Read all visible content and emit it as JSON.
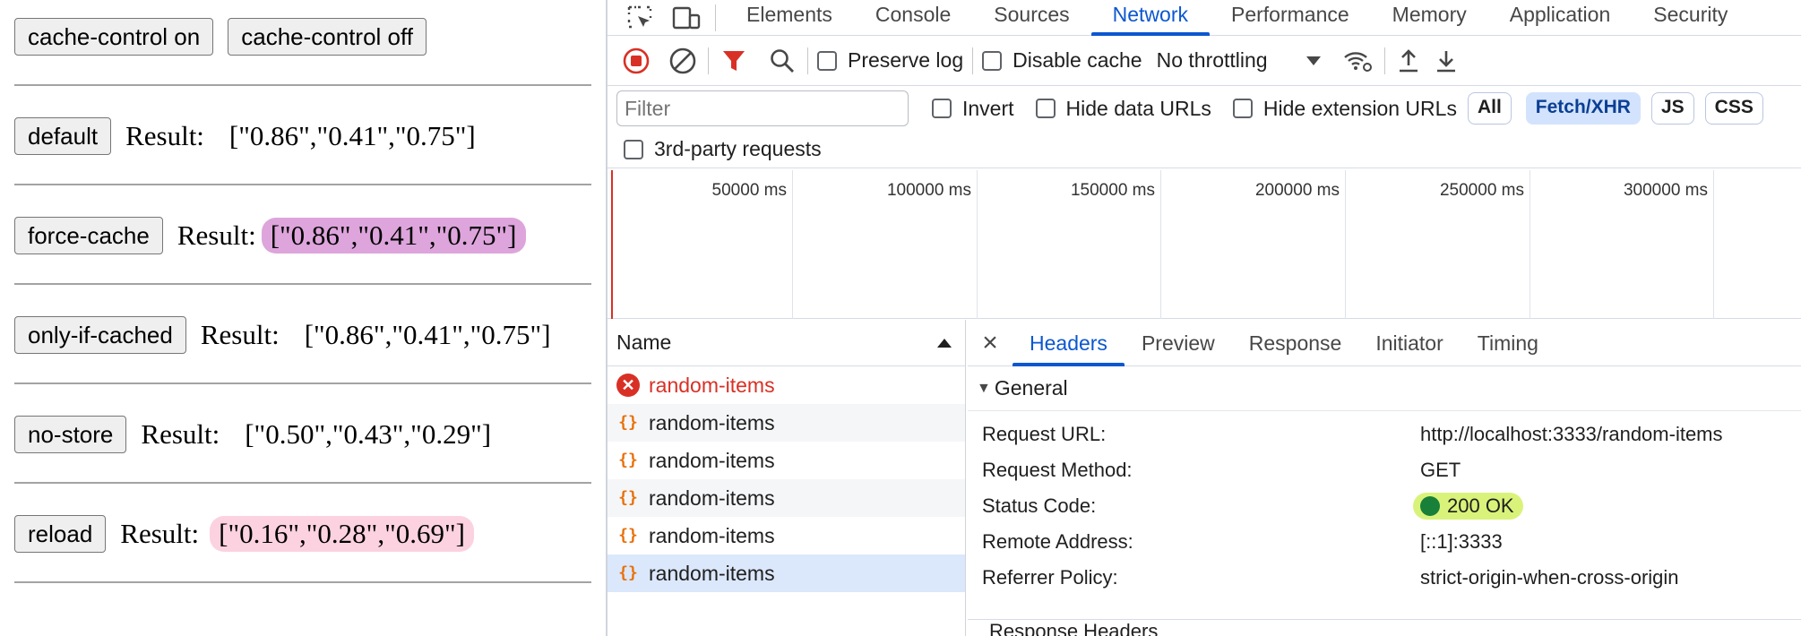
{
  "page": {
    "top_buttons": [
      "cache-control on",
      "cache-control off"
    ],
    "result_label": "Result:",
    "rows": [
      {
        "button": "default",
        "value": "[\"0.86\",\"0.41\",\"0.75\"]"
      },
      {
        "button": "force-cache",
        "value": "[\"0.86\",\"0.41\",\"0.75\"]"
      },
      {
        "button": "only-if-cached",
        "value": "[\"0.86\",\"0.41\",\"0.75\"]"
      },
      {
        "button": "no-store",
        "value": "[\"0.50\",\"0.43\",\"0.29\"]"
      },
      {
        "button": "reload",
        "value": "[\"0.16\",\"0.28\",\"0.69\"]"
      }
    ],
    "highlight_colors": {
      "force_cache": "#dda5db",
      "reload": "#fcd2e0"
    }
  },
  "devtools": {
    "tabs": [
      "Elements",
      "Console",
      "Sources",
      "Network",
      "Performance",
      "Memory",
      "Application",
      "Security"
    ],
    "active_tab": "Network",
    "toolbar": {
      "preserve_log": "Preserve log",
      "disable_cache": "Disable cache",
      "throttling": "No throttling"
    },
    "filter": {
      "placeholder": "Filter",
      "invert": "Invert",
      "hide_data_urls": "Hide data URLs",
      "hide_extension_urls": "Hide extension URLs",
      "chips": [
        "All",
        "Fetch/XHR",
        "JS",
        "CSS"
      ],
      "active_chip": "Fetch/XHR",
      "third_party": "3rd-party requests"
    },
    "timeline_ticks": [
      "50000 ms",
      "100000 ms",
      "150000 ms",
      "200000 ms",
      "250000 ms",
      "300000 ms"
    ],
    "request_list": {
      "header": "Name",
      "items": [
        {
          "name": "random-items",
          "status": "error"
        },
        {
          "name": "random-items",
          "status": "ok"
        },
        {
          "name": "random-items",
          "status": "ok"
        },
        {
          "name": "random-items",
          "status": "ok"
        },
        {
          "name": "random-items",
          "status": "ok"
        },
        {
          "name": "random-items",
          "status": "ok"
        }
      ]
    },
    "detail": {
      "tabs": [
        "Headers",
        "Preview",
        "Response",
        "Initiator",
        "Timing"
      ],
      "active_tab": "Headers",
      "section": "General",
      "fields": [
        {
          "key": "Request URL:",
          "value": "http://localhost:3333/random-items"
        },
        {
          "key": "Request Method:",
          "value": "GET"
        },
        {
          "key": "Status Code:",
          "value": "200 OK"
        },
        {
          "key": "Remote Address:",
          "value": "[::1]:3333"
        },
        {
          "key": "Referrer Policy:",
          "value": "strict-origin-when-cross-origin"
        }
      ],
      "next_section": "Response Headers"
    },
    "colors": {
      "accent": "#0b57d0",
      "error": "#d93025",
      "status_ok": "#188038",
      "status_pill": "#d9f37a"
    }
  }
}
